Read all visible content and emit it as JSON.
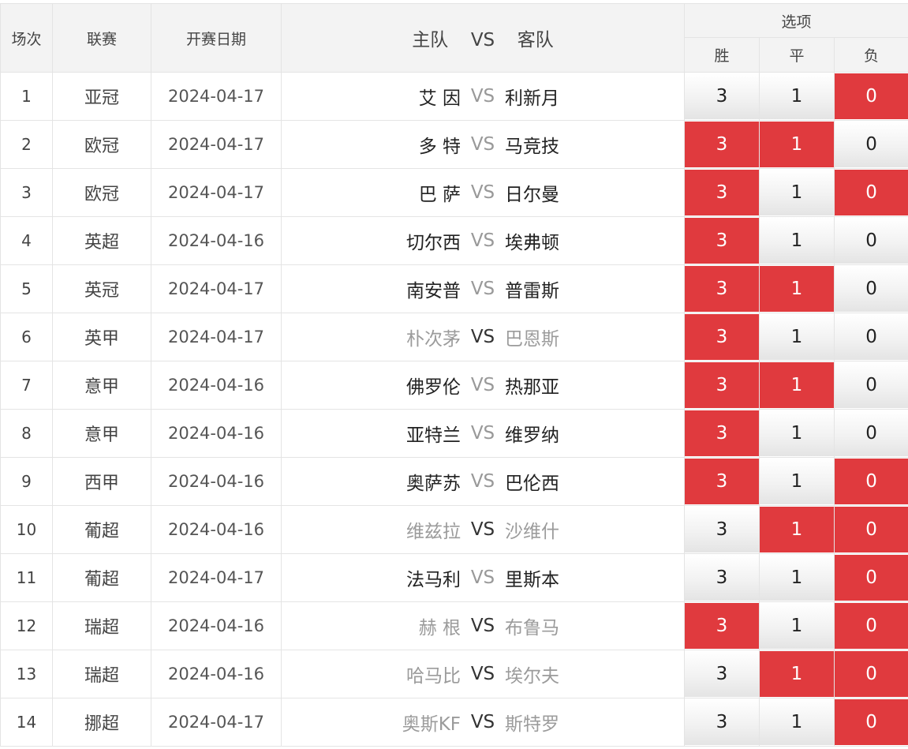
{
  "headers": {
    "index": "场次",
    "league": "联赛",
    "date": "开赛日期",
    "match_home": "主队",
    "match_vs": "VS",
    "match_away": "客队",
    "options": "选项",
    "win": "胜",
    "draw": "平",
    "lose": "负"
  },
  "colors": {
    "selected_bg": "#e03a3e",
    "unselected_bg": "#f2f2f2",
    "dim_team_text": "#9b9b9b"
  },
  "rows": [
    {
      "index": "1",
      "league": "亚冠",
      "date": "2024-04-17",
      "home": "艾 因",
      "vs": "VS",
      "away": "利新月",
      "win": "3",
      "draw": "1",
      "lose": "0",
      "win_selected": false,
      "draw_selected": false,
      "lose_selected": true,
      "home_dim": false,
      "away_dim": false
    },
    {
      "index": "2",
      "league": "欧冠",
      "date": "2024-04-17",
      "home": "多 特",
      "vs": "VS",
      "away": "马竞技",
      "win": "3",
      "draw": "1",
      "lose": "0",
      "win_selected": true,
      "draw_selected": true,
      "lose_selected": false,
      "home_dim": false,
      "away_dim": false
    },
    {
      "index": "3",
      "league": "欧冠",
      "date": "2024-04-17",
      "home": "巴 萨",
      "vs": "VS",
      "away": "日尔曼",
      "win": "3",
      "draw": "1",
      "lose": "0",
      "win_selected": true,
      "draw_selected": false,
      "lose_selected": true,
      "home_dim": false,
      "away_dim": false
    },
    {
      "index": "4",
      "league": "英超",
      "date": "2024-04-16",
      "home": "切尔西",
      "vs": "VS",
      "away": "埃弗顿",
      "win": "3",
      "draw": "1",
      "lose": "0",
      "win_selected": true,
      "draw_selected": false,
      "lose_selected": false,
      "home_dim": false,
      "away_dim": false
    },
    {
      "index": "5",
      "league": "英冠",
      "date": "2024-04-17",
      "home": "南安普",
      "vs": "VS",
      "away": "普雷斯",
      "win": "3",
      "draw": "1",
      "lose": "0",
      "win_selected": true,
      "draw_selected": true,
      "lose_selected": false,
      "home_dim": false,
      "away_dim": false
    },
    {
      "index": "6",
      "league": "英甲",
      "date": "2024-04-17",
      "home": "朴次茅",
      "vs": "VS",
      "away": "巴恩斯",
      "win": "3",
      "draw": "1",
      "lose": "0",
      "win_selected": true,
      "draw_selected": false,
      "lose_selected": false,
      "home_dim": true,
      "away_dim": true
    },
    {
      "index": "7",
      "league": "意甲",
      "date": "2024-04-16",
      "home": "佛罗伦",
      "vs": "VS",
      "away": "热那亚",
      "win": "3",
      "draw": "1",
      "lose": "0",
      "win_selected": true,
      "draw_selected": true,
      "lose_selected": false,
      "home_dim": false,
      "away_dim": false
    },
    {
      "index": "8",
      "league": "意甲",
      "date": "2024-04-16",
      "home": "亚特兰",
      "vs": "VS",
      "away": "维罗纳",
      "win": "3",
      "draw": "1",
      "lose": "0",
      "win_selected": true,
      "draw_selected": false,
      "lose_selected": false,
      "home_dim": false,
      "away_dim": false
    },
    {
      "index": "9",
      "league": "西甲",
      "date": "2024-04-16",
      "home": "奥萨苏",
      "vs": "VS",
      "away": "巴伦西",
      "win": "3",
      "draw": "1",
      "lose": "0",
      "win_selected": true,
      "draw_selected": false,
      "lose_selected": true,
      "home_dim": false,
      "away_dim": false
    },
    {
      "index": "10",
      "league": "葡超",
      "date": "2024-04-16",
      "home": "维兹拉",
      "vs": "VS",
      "away": "沙维什",
      "win": "3",
      "draw": "1",
      "lose": "0",
      "win_selected": false,
      "draw_selected": true,
      "lose_selected": true,
      "home_dim": true,
      "away_dim": true
    },
    {
      "index": "11",
      "league": "葡超",
      "date": "2024-04-17",
      "home": "法马利",
      "vs": "VS",
      "away": "里斯本",
      "win": "3",
      "draw": "1",
      "lose": "0",
      "win_selected": false,
      "draw_selected": false,
      "lose_selected": true,
      "home_dim": false,
      "away_dim": false
    },
    {
      "index": "12",
      "league": "瑞超",
      "date": "2024-04-16",
      "home": "赫 根",
      "vs": "VS",
      "away": "布鲁马",
      "win": "3",
      "draw": "1",
      "lose": "0",
      "win_selected": true,
      "draw_selected": false,
      "lose_selected": true,
      "home_dim": true,
      "away_dim": true
    },
    {
      "index": "13",
      "league": "瑞超",
      "date": "2024-04-16",
      "home": "哈马比",
      "vs": "VS",
      "away": "埃尔夫",
      "win": "3",
      "draw": "1",
      "lose": "0",
      "win_selected": false,
      "draw_selected": true,
      "lose_selected": true,
      "home_dim": true,
      "away_dim": true
    },
    {
      "index": "14",
      "league": "挪超",
      "date": "2024-04-17",
      "home": "奥斯KF",
      "vs": "VS",
      "away": "斯特罗",
      "win": "3",
      "draw": "1",
      "lose": "0",
      "win_selected": false,
      "draw_selected": false,
      "lose_selected": true,
      "home_dim": true,
      "away_dim": true
    }
  ]
}
